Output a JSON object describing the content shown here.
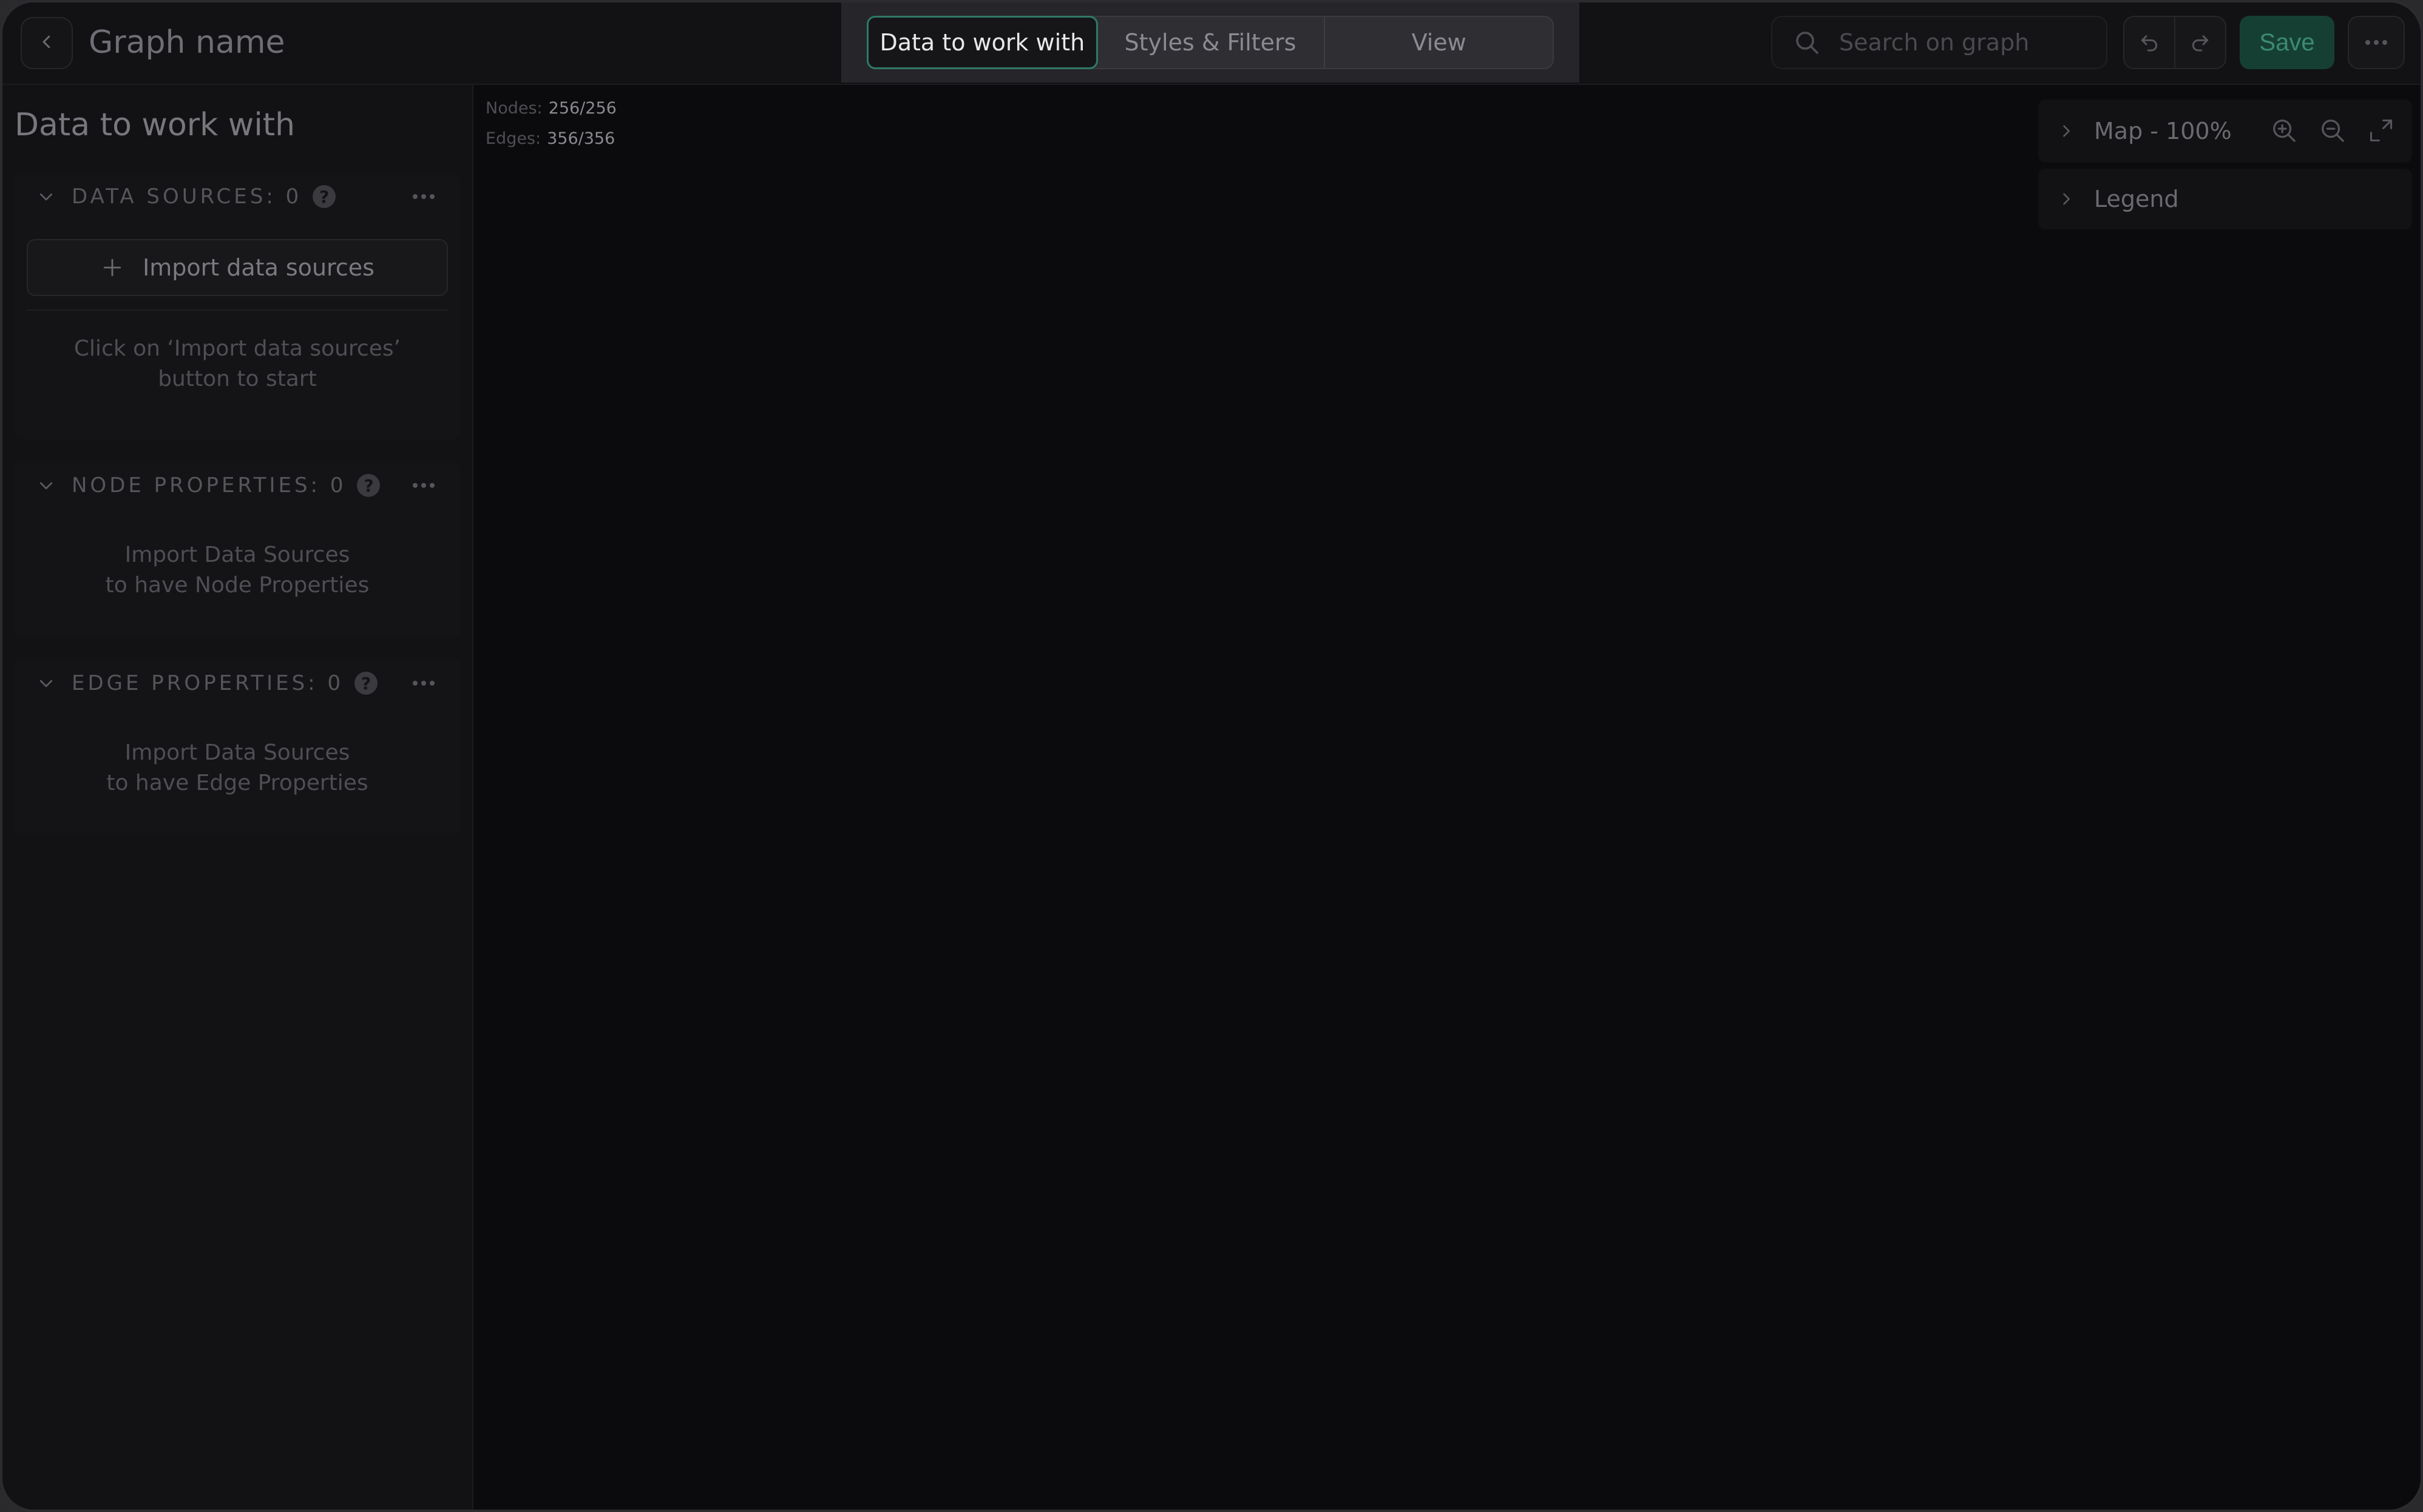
{
  "header": {
    "title": "Graph name",
    "tabs": [
      {
        "label": "Data to work with",
        "active": true
      },
      {
        "label": "Styles & Filters",
        "active": false
      },
      {
        "label": "View",
        "active": false
      }
    ],
    "search_placeholder": "Search on graph",
    "save_label": "Save"
  },
  "sidebar": {
    "title": "Data to work with",
    "data_sources": {
      "label": "DATA SOURCES: 0",
      "import_label": "Import data sources",
      "hint": "Click on ‘Import data sources’ button to start"
    },
    "node_properties": {
      "label": "NODE PROPERTIES: 0",
      "hint_line1": "Import Data Sources",
      "hint_line2": "to have Node Properties"
    },
    "edge_properties": {
      "label": "EDGE PROPERTIES: 0",
      "hint_line1": "Import Data Sources",
      "hint_line2": "to have Edge Properties"
    }
  },
  "canvas": {
    "nodes_label": "Nodes:",
    "nodes_value": "256/256",
    "edges_label": "Edges:",
    "edges_value": "356/356",
    "map_label": "Map - 100%",
    "legend_label": "Legend"
  },
  "colors": {
    "accent": "#2f7a66",
    "save_bg": "#163f33",
    "background": "#0b0b0d"
  },
  "icons": [
    "chevron-left-icon",
    "search-icon",
    "undo-icon",
    "redo-icon",
    "more-horizontal-icon",
    "chevron-down-icon",
    "help-icon",
    "plus-icon",
    "chevron-right-icon",
    "zoom-in-icon",
    "zoom-out-icon",
    "fullscreen-icon"
  ]
}
